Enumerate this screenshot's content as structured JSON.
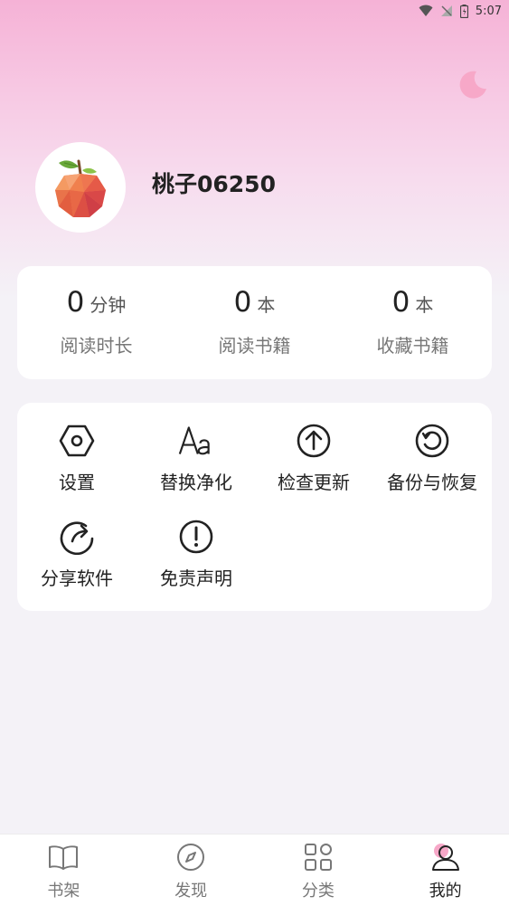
{
  "status_bar": {
    "time": "5:07"
  },
  "profile": {
    "username": "桃子06250"
  },
  "stats": [
    {
      "value": "0",
      "unit": "分钟",
      "label": "阅读时长"
    },
    {
      "value": "0",
      "unit": "本",
      "label": "阅读书籍"
    },
    {
      "value": "0",
      "unit": "本",
      "label": "收藏书籍"
    }
  ],
  "menu": [
    {
      "label": "设置",
      "icon": "settings-hex-icon"
    },
    {
      "label": "替换净化",
      "icon": "font-aa-icon"
    },
    {
      "label": "检查更新",
      "icon": "arrow-up-circle-icon"
    },
    {
      "label": "备份与恢复",
      "icon": "restore-icon"
    },
    {
      "label": "分享软件",
      "icon": "share-icon"
    },
    {
      "label": "免责声明",
      "icon": "exclamation-circle-icon"
    }
  ],
  "tabs": [
    {
      "label": "书架",
      "icon": "book-icon",
      "active": false
    },
    {
      "label": "发现",
      "icon": "compass-icon",
      "active": false
    },
    {
      "label": "分类",
      "icon": "grid-icon",
      "active": false
    },
    {
      "label": "我的",
      "icon": "person-icon",
      "active": true
    }
  ],
  "colors": {
    "accent_pink": "#f7a8c8",
    "text_dark": "#222222",
    "text_muted": "#777777"
  }
}
